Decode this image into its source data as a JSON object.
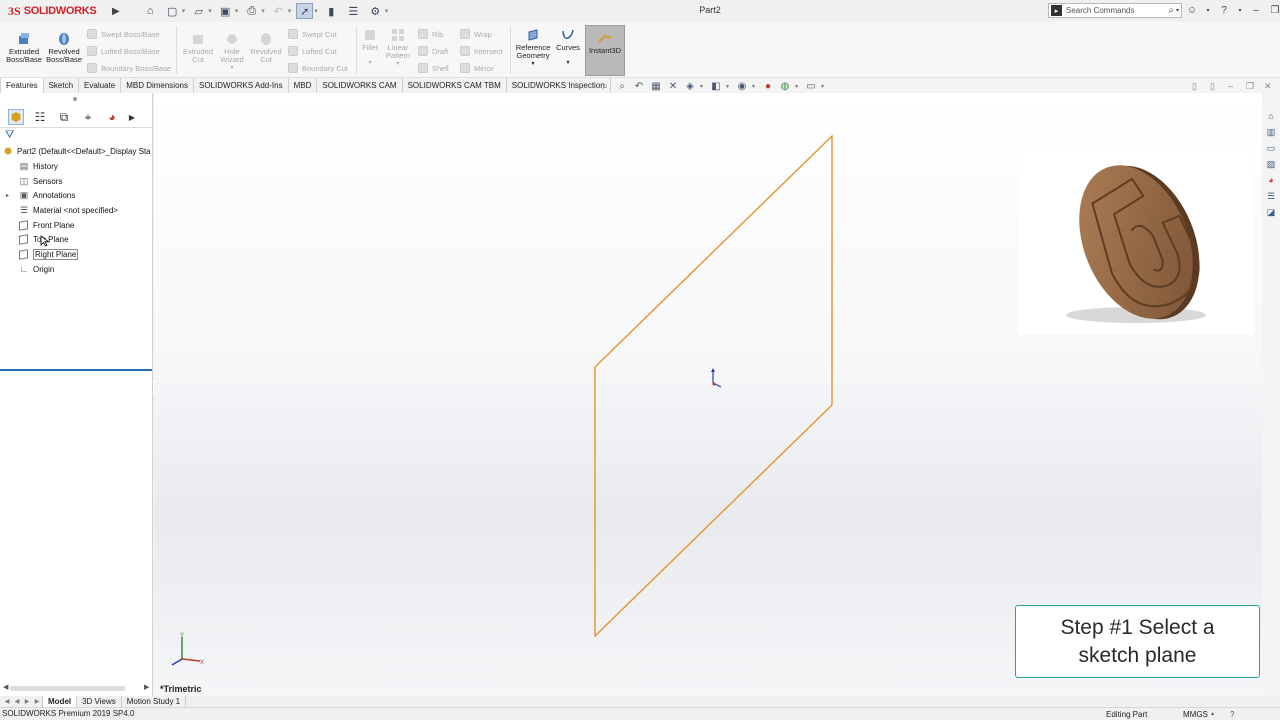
{
  "app": {
    "brand": "SOLIDWORKS",
    "document_title": "Part2"
  },
  "search": {
    "placeholder": "Search Commands"
  },
  "ribbon": {
    "extruded_boss": "Extruded\nBoss/Base",
    "revolved_boss": "Revolved\nBoss/Base",
    "swept_boss": "Swept Boss/Base",
    "lofted_boss": "Lofted Boss/Base",
    "boundary_boss": "Boundary Boss/Base",
    "extruded_cut": "Extruded\nCut",
    "hole_wizard": "Hole\nWizard",
    "revolved_cut": "Revolved\nCut",
    "swept_cut": "Swept Cut",
    "lofted_cut": "Lofted Cut",
    "boundary_cut": "Boundary Cut",
    "fillet": "Fillet",
    "linear_pattern": "Linear\nPattern",
    "rib": "Rib",
    "draft": "Draft",
    "shell": "Shell",
    "wrap": "Wrap",
    "intersect": "Intersect",
    "mirror": "Mirror",
    "reference_geometry": "Reference\nGeometry",
    "curves": "Curves",
    "instant3d": "Instant3D"
  },
  "command_tabs": [
    "Features",
    "Sketch",
    "Evaluate",
    "MBD Dimensions",
    "SOLIDWORKS Add-Ins",
    "MBD",
    "SOLIDWORKS CAM",
    "SOLIDWORKS CAM TBM",
    "SOLIDWORKS Inspection"
  ],
  "feature_tree": {
    "root": "Part2  (Default<<Default>_Display Sta",
    "items": [
      "History",
      "Sensors",
      "Annotations",
      "Material <not specified>",
      "Front Plane",
      "Top Plane",
      "Right Plane",
      "Origin"
    ]
  },
  "viewport": {
    "view_name": "*Trimetric",
    "plane_color": "#e8922f",
    "step_callout": "Step #1 Select a sketch plane",
    "callout_border": "#2aa198"
  },
  "bottom_tabs": [
    "Model",
    "3D Views",
    "Motion Study 1"
  ],
  "status_bar": {
    "version": "SOLIDWORKS Premium 2019 SP4.0",
    "mode": "Editing Part",
    "units": "MMGS"
  }
}
